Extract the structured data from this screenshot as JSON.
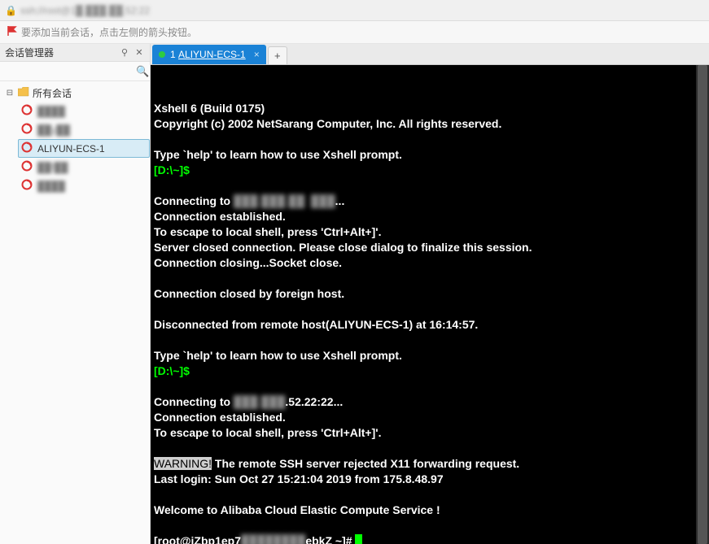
{
  "address_bar": {
    "text": "ssh://root@1█.███.██.52:22"
  },
  "hint_bar": {
    "text": "要添加当前会话，点击左侧的箭头按钮。"
  },
  "sidebar": {
    "title": "会话管理器",
    "pin_symbol": "📌",
    "close_symbol": "✕",
    "search_placeholder": "",
    "root": {
      "label": "所有会话"
    },
    "items": [
      {
        "label": "████",
        "selected": false
      },
      {
        "label": "██y██",
        "selected": false
      },
      {
        "label": "ALIYUN-ECS-1",
        "selected": true
      },
      {
        "label": "██f██",
        "selected": false
      },
      {
        "label": "████",
        "selected": false
      }
    ]
  },
  "tabs": {
    "active": {
      "index": "1",
      "title": "ALIYUN-ECS-1"
    }
  },
  "terminal": {
    "lines": [
      {
        "parts": [
          {
            "t": "Xshell 6 (Build 0175)",
            "cls": "bold"
          }
        ]
      },
      {
        "parts": [
          {
            "t": "Copyright (c) 2002 NetSarang Computer, Inc. All rights reserved.",
            "cls": "bold"
          }
        ]
      },
      {
        "parts": [
          {
            "t": " "
          }
        ]
      },
      {
        "parts": [
          {
            "t": "Type `help' to learn how to use Xshell prompt.",
            "cls": "bold"
          }
        ]
      },
      {
        "parts": [
          {
            "t": "[D:\\~]$ ",
            "cls": "green"
          }
        ]
      },
      {
        "parts": [
          {
            "t": " "
          }
        ]
      },
      {
        "parts": [
          {
            "t": "Connecting to ",
            "cls": "bold"
          },
          {
            "t": "███.███.██  ███",
            "cls": "blur-term"
          },
          {
            "t": "...",
            "cls": "bold"
          }
        ]
      },
      {
        "parts": [
          {
            "t": "Connection established.",
            "cls": "bold"
          }
        ]
      },
      {
        "parts": [
          {
            "t": "To escape to local shell, press 'Ctrl+Alt+]'.",
            "cls": "bold"
          }
        ]
      },
      {
        "parts": [
          {
            "t": "Server closed connection. Please close dialog to finalize this session.",
            "cls": "bold"
          }
        ]
      },
      {
        "parts": [
          {
            "t": "Connection closing...Socket close.",
            "cls": "bold"
          }
        ]
      },
      {
        "parts": [
          {
            "t": " "
          }
        ]
      },
      {
        "parts": [
          {
            "t": "Connection closed by foreign host.",
            "cls": "bold"
          }
        ]
      },
      {
        "parts": [
          {
            "t": " "
          }
        ]
      },
      {
        "parts": [
          {
            "t": "Disconnected from remote host(ALIYUN-ECS-1) at 16:14:57.",
            "cls": "bold"
          }
        ]
      },
      {
        "parts": [
          {
            "t": " "
          }
        ]
      },
      {
        "parts": [
          {
            "t": "Type `help' to learn how to use Xshell prompt.",
            "cls": "bold"
          }
        ]
      },
      {
        "parts": [
          {
            "t": "[D:\\~]$ ",
            "cls": "green"
          }
        ]
      },
      {
        "parts": [
          {
            "t": " "
          }
        ]
      },
      {
        "parts": [
          {
            "t": "Connecting to ",
            "cls": "bold"
          },
          {
            "t": "███.███",
            "cls": "blur-term"
          },
          {
            "t": ".52.22:22...",
            "cls": "bold"
          }
        ]
      },
      {
        "parts": [
          {
            "t": "Connection established.",
            "cls": "bold"
          }
        ]
      },
      {
        "parts": [
          {
            "t": "To escape to local shell, press 'Ctrl+Alt+]'.",
            "cls": "bold"
          }
        ]
      },
      {
        "parts": [
          {
            "t": " "
          }
        ]
      },
      {
        "parts": [
          {
            "t": "WARNING!",
            "cls": "hl"
          },
          {
            "t": " The remote SSH server rejected X11 forwarding request.",
            "cls": "bold"
          }
        ]
      },
      {
        "parts": [
          {
            "t": "Last login: Sun Oct 27 15:21:04 2019 from 175.8.48.97",
            "cls": "bold"
          }
        ]
      },
      {
        "parts": [
          {
            "t": " "
          }
        ]
      },
      {
        "parts": [
          {
            "t": "Welcome to Alibaba Cloud Elastic Compute Service !",
            "cls": "bold"
          }
        ]
      },
      {
        "parts": [
          {
            "t": " "
          }
        ]
      },
      {
        "parts": [
          {
            "t": "[root@iZbp1ep7",
            "cls": "bold"
          },
          {
            "t": "████████",
            "cls": "blur-term"
          },
          {
            "t": "ebkZ ~]# ",
            "cls": "bold"
          },
          {
            "cursor": true
          }
        ]
      }
    ]
  }
}
